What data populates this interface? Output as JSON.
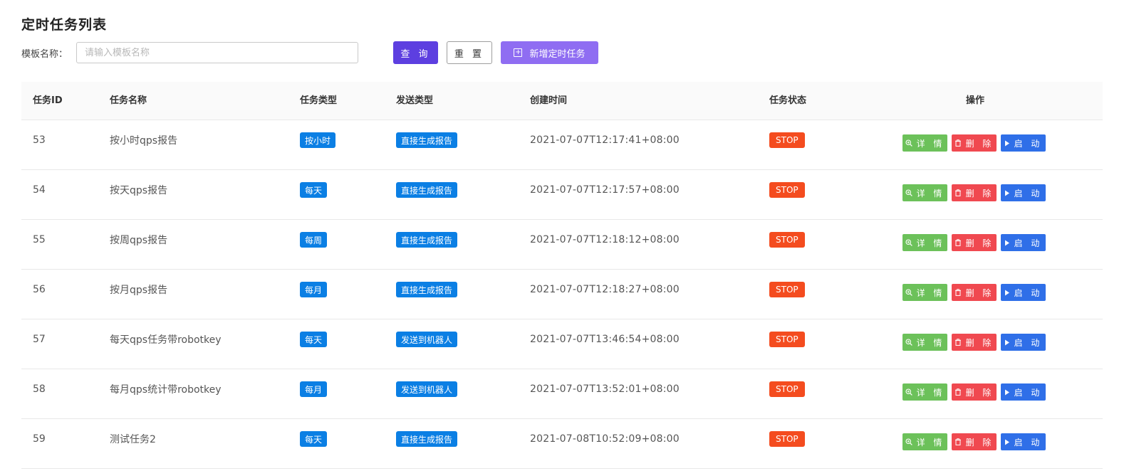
{
  "page": {
    "title": "定时任务列表"
  },
  "filter": {
    "label": "模板名称：",
    "placeholder": "请输入模板名称",
    "value": "",
    "query_label": "查 询",
    "reset_label": "重 置",
    "add_label": "新增定时任务"
  },
  "table": {
    "headers": {
      "id": "任务ID",
      "name": "任务名称",
      "type": "任务类型",
      "send_type": "发送类型",
      "created": "创建时间",
      "status": "任务状态",
      "ops": "操作"
    },
    "actions": {
      "detail": "详 情",
      "delete": "删 除",
      "start": "启 动"
    },
    "rows": [
      {
        "id": "53",
        "name": "按小时qps报告",
        "type": "按小时",
        "send_type": "直接生成报告",
        "created": "2021-07-07T12:17:41+08:00",
        "status": "STOP"
      },
      {
        "id": "54",
        "name": "按天qps报告",
        "type": "每天",
        "send_type": "直接生成报告",
        "created": "2021-07-07T12:17:57+08:00",
        "status": "STOP"
      },
      {
        "id": "55",
        "name": "按周qps报告",
        "type": "每周",
        "send_type": "直接生成报告",
        "created": "2021-07-07T12:18:12+08:00",
        "status": "STOP"
      },
      {
        "id": "56",
        "name": "按月qps报告",
        "type": "每月",
        "send_type": "直接生成报告",
        "created": "2021-07-07T12:18:27+08:00",
        "status": "STOP"
      },
      {
        "id": "57",
        "name": "每天qps任务带robotkey",
        "type": "每天",
        "send_type": "发送到机器人",
        "created": "2021-07-07T13:46:54+08:00",
        "status": "STOP"
      },
      {
        "id": "58",
        "name": "每月qps统计带robotkey",
        "type": "每月",
        "send_type": "发送到机器人",
        "created": "2021-07-07T13:52:01+08:00",
        "status": "STOP"
      },
      {
        "id": "59",
        "name": "测试任务2",
        "type": "每天",
        "send_type": "直接生成报告",
        "created": "2021-07-08T10:52:09+08:00",
        "status": "STOP"
      }
    ]
  },
  "colors": {
    "primary": "#5d3fe0",
    "add_button": "#8f6df2",
    "tag_blue": "#0b7fe4",
    "status_stop": "#f44c1f",
    "detail": "#6cc15a",
    "delete": "#f04950",
    "start": "#2f6fe8"
  },
  "icons": {
    "add": "plus-square-icon",
    "detail": "zoom-in-icon",
    "delete": "trash-icon",
    "start": "play-icon"
  }
}
